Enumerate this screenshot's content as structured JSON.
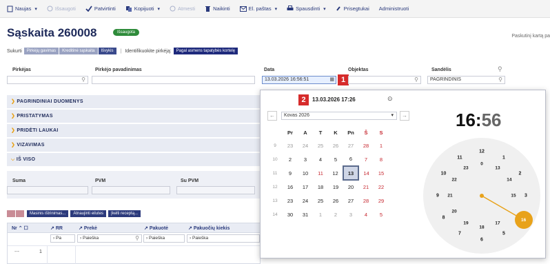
{
  "toolbar": {
    "items": [
      {
        "label": "Naujas",
        "icon": "new-doc-icon",
        "caret": true,
        "disabled": false
      },
      {
        "label": "Išsaugoti",
        "icon": "save-icon",
        "caret": false,
        "disabled": true
      },
      {
        "label": "Patvirtinti",
        "icon": "check-icon",
        "caret": false,
        "disabled": false
      },
      {
        "label": "Kopijuoti",
        "icon": "copy-icon",
        "caret": true,
        "disabled": false
      },
      {
        "label": "Atmesti",
        "icon": "reject-icon",
        "caret": false,
        "disabled": true
      },
      {
        "label": "Naikinti",
        "icon": "trash-icon",
        "caret": false,
        "disabled": false
      },
      {
        "label": "El. paštas",
        "icon": "mail-icon",
        "caret": true,
        "disabled": false
      },
      {
        "label": "Spausdinti",
        "icon": "print-icon",
        "caret": true,
        "disabled": false
      },
      {
        "label": "Prisegtukai",
        "icon": "paperclip-icon",
        "caret": false,
        "disabled": false
      },
      {
        "label": "Administruoti",
        "icon": "",
        "caret": false,
        "disabled": false
      }
    ]
  },
  "title": "Sąskaita 260008",
  "badge": "Išsaugota",
  "last_modified": "Paskutinį kartą pa",
  "create_row": {
    "label": "Sukurti",
    "buttons": [
      "Pirkėjų gavimas",
      "Kreditinė sąskaita",
      "Išvykis"
    ],
    "separator": "|",
    "identify_label": "Identifikuokite pirkėją:",
    "identify_button": "Pagal asmens tapatybės kortelę"
  },
  "fields": {
    "buyer_label": "Pirkėjas",
    "buyer_name_label": "Pirkėjo pavadinimas",
    "date_label": "Data",
    "date_value": "13.03.2026 16:56:51",
    "object_label": "Objektas",
    "warehouse_label": "Sandėlis",
    "warehouse_value": "PAGRINDINIS"
  },
  "sections": [
    "PAGRINDINIAI DUOMENYS",
    "PRISTATYMAS",
    "PRIDĖTI LAUKAI",
    "VIZAVIMAS",
    "IŠ VISO"
  ],
  "totals": {
    "sum_label": "Suma",
    "vat_label": "PVM",
    "with_vat_label": "Su PVM"
  },
  "table_buttons": [
    "Masinis ištrinimas...",
    "Atnaujinti eilutes",
    "Įkelti receptą..."
  ],
  "table": {
    "headers": [
      "Nr",
      "RR",
      "Prekė",
      "Pakuotė",
      "Pakuočių kiekis"
    ],
    "filters": [
      "Pa",
      "Paieška",
      "Paieška",
      "Paieška"
    ],
    "row_dash": "---",
    "row_num": "1"
  },
  "picker": {
    "marker1": "1",
    "marker2": "2",
    "header_value": "13.03.2026 17:26",
    "month": "Kovas 2026",
    "weekdays": [
      "Pr",
      "A",
      "T",
      "K",
      "Pn",
      "Š",
      "S"
    ],
    "weeks": [
      {
        "w": "9",
        "d": [
          "23",
          "24",
          "25",
          "26",
          "27",
          "28",
          "1"
        ]
      },
      {
        "w": "10",
        "d": [
          "2",
          "3",
          "4",
          "5",
          "6",
          "7",
          "8"
        ]
      },
      {
        "w": "11",
        "d": [
          "9",
          "10",
          "11",
          "12",
          "13",
          "14",
          "15"
        ]
      },
      {
        "w": "12",
        "d": [
          "16",
          "17",
          "18",
          "19",
          "20",
          "21",
          "22"
        ]
      },
      {
        "w": "13",
        "d": [
          "23",
          "24",
          "25",
          "26",
          "27",
          "28",
          "29"
        ]
      },
      {
        "w": "14",
        "d": [
          "30",
          "31",
          "1",
          "2",
          "3",
          "4",
          "5"
        ]
      }
    ],
    "time_hour": "16",
    "time_sep": ":",
    "time_min": "56",
    "clock_outer": [
      "12",
      "1",
      "2",
      "3",
      "4",
      "5",
      "6",
      "7",
      "8",
      "9",
      "10",
      "11"
    ],
    "clock_inner": [
      "0",
      "13",
      "14",
      "15",
      "16",
      "17",
      "18",
      "19",
      "20",
      "21",
      "22",
      "23"
    ],
    "selected_hour": "16"
  },
  "colors": {
    "navy": "#1e2a5a",
    "accent": "#e8a21a",
    "marker": "#d62b2b",
    "today": "#cfd6e6"
  }
}
